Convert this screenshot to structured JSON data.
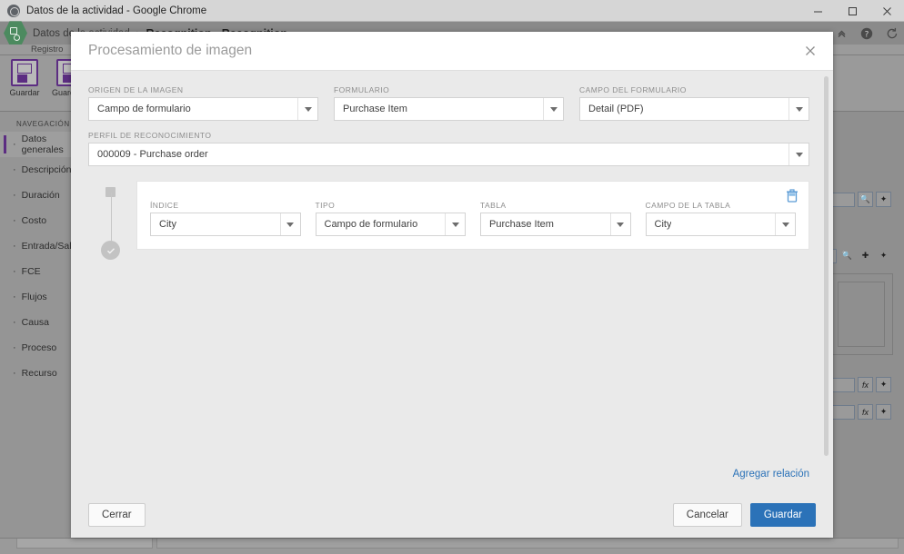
{
  "window": {
    "title": "Datos de la actividad - Google Chrome",
    "favicon": "chrome-icon",
    "controls": {
      "minimize": "minimize-icon",
      "maximize": "maximize-icon",
      "close": "close-icon"
    }
  },
  "app": {
    "logo": "bizagi-hex-logo",
    "breadcrumb": {
      "root": "Datos de la actividad",
      "separator": "›",
      "current": "Recognition - Recognition"
    },
    "header_icons": [
      {
        "name": "collapse-chevron-icon",
        "glyph": "«"
      },
      {
        "name": "help-icon",
        "glyph": "?"
      },
      {
        "name": "refresh-icon",
        "glyph": "↻"
      }
    ],
    "tab_label": "Registro",
    "ribbon": [
      {
        "name": "save-ribbon-button",
        "label": "Guardar"
      },
      {
        "name": "save-and-ribbon-button",
        "label": "Guardar y"
      }
    ],
    "nav": {
      "title": "NAVEGACIÓN",
      "items": [
        {
          "label": "Datos generales",
          "active": true
        },
        {
          "label": "Descripción",
          "active": false
        },
        {
          "label": "Duración",
          "active": false
        },
        {
          "label": "Costo",
          "active": false
        },
        {
          "label": "Entrada/Salida",
          "active": false
        },
        {
          "label": "FCE",
          "active": false
        },
        {
          "label": "Flujos",
          "active": false
        },
        {
          "label": "Causa",
          "active": false
        },
        {
          "label": "Proceso",
          "active": false
        },
        {
          "label": "Recurso",
          "active": false
        }
      ]
    },
    "right_panel_icons": {
      "search": "search-icon",
      "add": "plus-icon",
      "wand": "magic-wand-icon",
      "formula": "fx-icon"
    }
  },
  "dialog": {
    "title": "Procesamiento de imagen",
    "close_icon": "close-icon",
    "fields": [
      {
        "name": "image-source",
        "label": "ORIGEN DE LA IMAGEN",
        "value": "Campo de formulario"
      },
      {
        "name": "form",
        "label": "FORMULARIO",
        "value": "Purchase Item"
      },
      {
        "name": "form-field",
        "label": "CAMPO DEL FORMULARIO",
        "value": "Detail (PDF)"
      }
    ],
    "profile": {
      "name": "recognition-profile",
      "label": "PERFIL DE RECONOCIMIENTO",
      "value": "000009 - Purchase order"
    },
    "relation": {
      "delete_icon": "trash-icon",
      "fields": [
        {
          "name": "index",
          "label": "ÍNDICE",
          "value": "City"
        },
        {
          "name": "type",
          "label": "TIPO",
          "value": "Campo de formulario"
        },
        {
          "name": "table",
          "label": "TABLA",
          "value": "Purchase Item"
        },
        {
          "name": "table-field",
          "label": "CAMPO DE LA TABLA",
          "value": "City"
        }
      ]
    },
    "add_relation_link": "Agregar relación",
    "buttons": {
      "close": "Cerrar",
      "cancel": "Cancelar",
      "save": "Guardar"
    }
  },
  "colors": {
    "primary": "#2b72b8",
    "link": "#2b72b8",
    "accent_purple": "#5c2d82",
    "logo_green": "#4c8a5f",
    "dialog_bg": "#eaeaea"
  }
}
